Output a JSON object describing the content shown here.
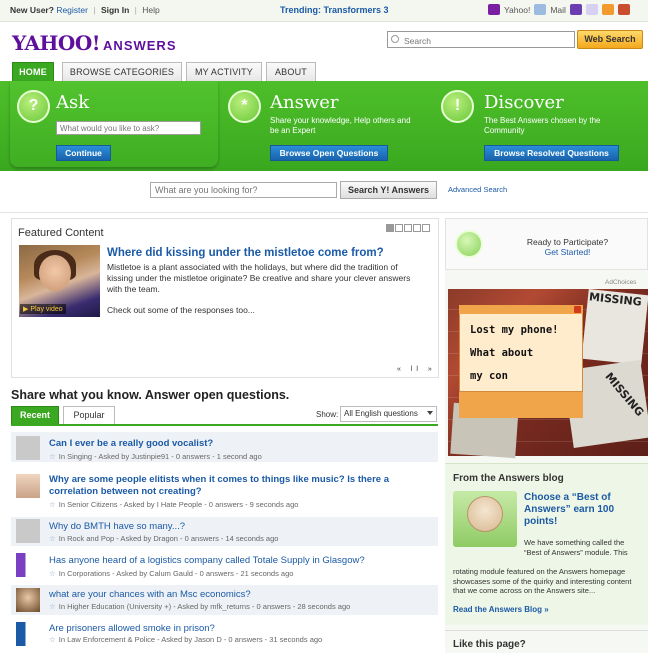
{
  "topbar": {
    "new_user": "New User?",
    "register": "Register",
    "sign_in": "Sign In",
    "help": "Help",
    "trending": "Trending: Transformers 3",
    "yahoo_link": "Yahoo!",
    "mail": "Mail"
  },
  "logo": {
    "brand": "YAHOO!",
    "product": "ANSWERS"
  },
  "search": {
    "placeholder": "Search",
    "button": "Web Search"
  },
  "tabs": [
    "HOME",
    "BROWSE CATEGORIES",
    "MY ACTIVITY",
    "ABOUT"
  ],
  "hero": {
    "ask": {
      "title": "Ask",
      "input_placeholder": "What would you like to ask?",
      "button": "Continue"
    },
    "answer": {
      "title": "Answer",
      "sub_line1": "Share your knowledge, Help others and",
      "sub_line2": "be an Expert",
      "button": "Browse Open Questions"
    },
    "discover": {
      "title": "Discover",
      "sub_line1": "The Best Answers chosen by the",
      "sub_line2": "Community",
      "button": "Browse Resolved Questions"
    }
  },
  "search2": {
    "placeholder": "What are you looking for?",
    "button": "Search Y! Answers",
    "advanced": "Advanced Search"
  },
  "featured": {
    "title": "Featured Content",
    "question": "Where did kissing under the mistletoe come from?",
    "desc_line1": "Mistletoe is a plant associated with the holidays, but where did the tradition of",
    "desc_line2": "kissing under the mistletoe originate? Be creative and share your clever answers",
    "desc_line3": "with the team.",
    "more": "Check out some of the responses too...",
    "play_label": "Play video",
    "controls": "« ll »"
  },
  "share": {
    "title": "Share what you know. Answer open questions.",
    "tab_recent": "Recent",
    "tab_popular": "Popular",
    "show_label": "Show:",
    "show_value": "All English questions"
  },
  "questions": [
    {
      "title": "Can I ever be a really good vocalist?",
      "meta": "In Singing - Asked by Justinpie91 - 0 answers - 1 second ago"
    },
    {
      "title": "Why are some people elitists when it comes to things like music? Is there a",
      "title2": "correlation between not creating?",
      "meta": "In Senior Citizens - Asked by I Hate People - 0 answers - 9 seconds ago"
    },
    {
      "title": "Why do BMTH have so many...?",
      "meta": "In Rock and Pop - Asked by Dragon - 0 answers - 14 seconds ago"
    },
    {
      "title": "Has anyone heard of a logistics company called Totale Supply in Glasgow?",
      "meta": "In Corporations - Asked by Calum Gauld - 0 answers - 21 seconds ago"
    },
    {
      "title": "what are your chances with an Msc economics?",
      "meta": "In Higher Education (University +) - Asked by mfk_returns - 0 answers - 28 seconds ago"
    },
    {
      "title": "Are prisoners allowed smoke in prison?",
      "meta": "In Law Enforcement & Police - Asked by Jason D - 0 answers - 31 seconds ago"
    }
  ],
  "participate": {
    "line1": "Ready to Participate?",
    "line2": "Get Started!"
  },
  "ad": {
    "adchoices": "AdChoices",
    "missing1": "MISSING",
    "missing2": "MISSING",
    "line1": "Lost my phone!",
    "line2": "What about",
    "line3": "my con"
  },
  "blog": {
    "title": "From the Answers blog",
    "headline": "Choose a “Best of Answers” earn 100 points!",
    "body1": "We have something called the “Best of Answers” module. This",
    "body2": "rotating module featured on the Answers homepage showcases some of the quirky and interesting content that we come across on the Answers site...",
    "link": "Read the Answers Blog »"
  },
  "like": {
    "title": "Like this page?"
  },
  "colors": {
    "green": "#3aa820",
    "link_blue": "#1b5aa6",
    "yahoo_purple": "#5e0f9d",
    "button_blue": "#1a62ad"
  }
}
